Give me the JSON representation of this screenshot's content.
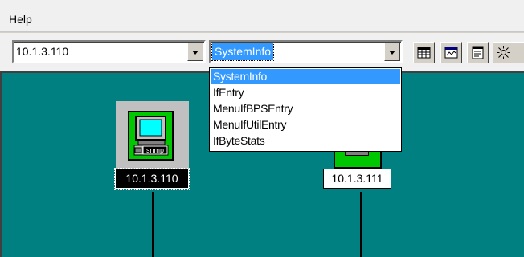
{
  "menubar": {
    "items": [
      "Help"
    ]
  },
  "toolbar": {
    "address_combo": {
      "value": "10.1.3.110"
    },
    "view_combo": {
      "value": "SystemInfo",
      "options": [
        "SystemInfo",
        "IfEntry",
        "MenuIfBPSEntry",
        "MenuIfUtilEntry",
        "IfByteStats"
      ],
      "selected_index": 0
    },
    "buttons": [
      "table-icon",
      "chart-icon",
      "document-icon",
      "sun-icon"
    ]
  },
  "map": {
    "background": "#008080",
    "nodes": [
      {
        "label": "10.1.3.110",
        "icon_text": "snmp",
        "selected": true
      },
      {
        "label": "10.1.3.111",
        "selected": false
      }
    ]
  },
  "colors": {
    "selection": "#3399ff",
    "node_green": "#00c800",
    "canvas": "#008080"
  }
}
